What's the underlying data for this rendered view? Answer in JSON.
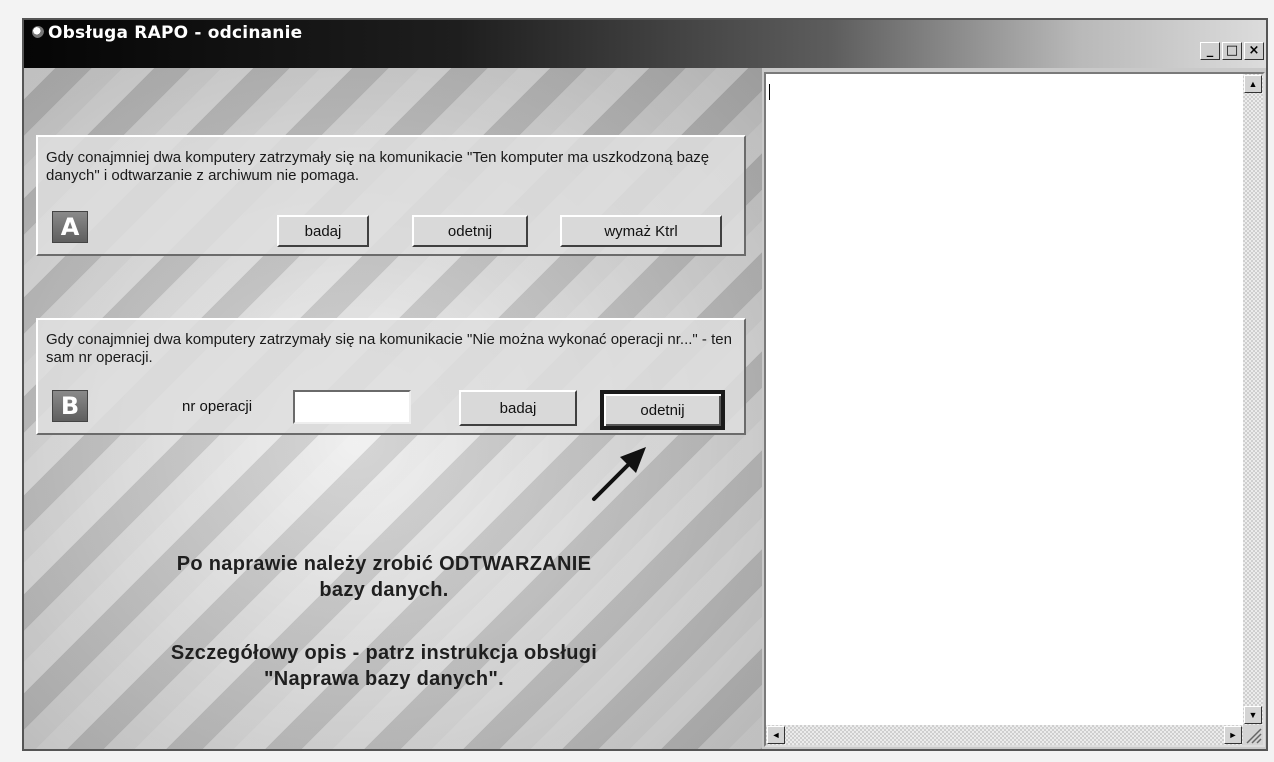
{
  "window": {
    "title": "Obsługa RAPO - odcinanie",
    "controls": {
      "minimize": "_",
      "maximize": "□",
      "close": "×"
    }
  },
  "panel_a": {
    "badge": "A",
    "description": "Gdy conajmniej dwa komputery zatrzymały się na komunikacie \"Ten komputer ma uszkodzoną bazę danych\" i odtwarzanie z archiwum nie pomaga.",
    "buttons": {
      "badaj": "badaj",
      "odetnij": "odetnij",
      "wymaz": "wymaż Ktrl"
    }
  },
  "panel_b": {
    "badge": "B",
    "description": "Gdy conajmniej dwa komputery zatrzymały się na komunikacie \"Nie można wykonać operacji nr...\" - ten sam nr operacji.",
    "op_label": "nr operacji",
    "op_value": "",
    "buttons": {
      "badaj": "badaj",
      "odetnij": "odetnij"
    }
  },
  "notes": {
    "line1": "Po naprawie należy zrobić ODTWARZANIE",
    "line2": "bazy danych.",
    "line3": "Szczegółowy opis - patrz instrukcja obsługi",
    "line4": "\"Naprawa bazy danych\"."
  },
  "scrollbar": {
    "up": "▲",
    "down": "▼",
    "left": "◄",
    "right": "►"
  }
}
